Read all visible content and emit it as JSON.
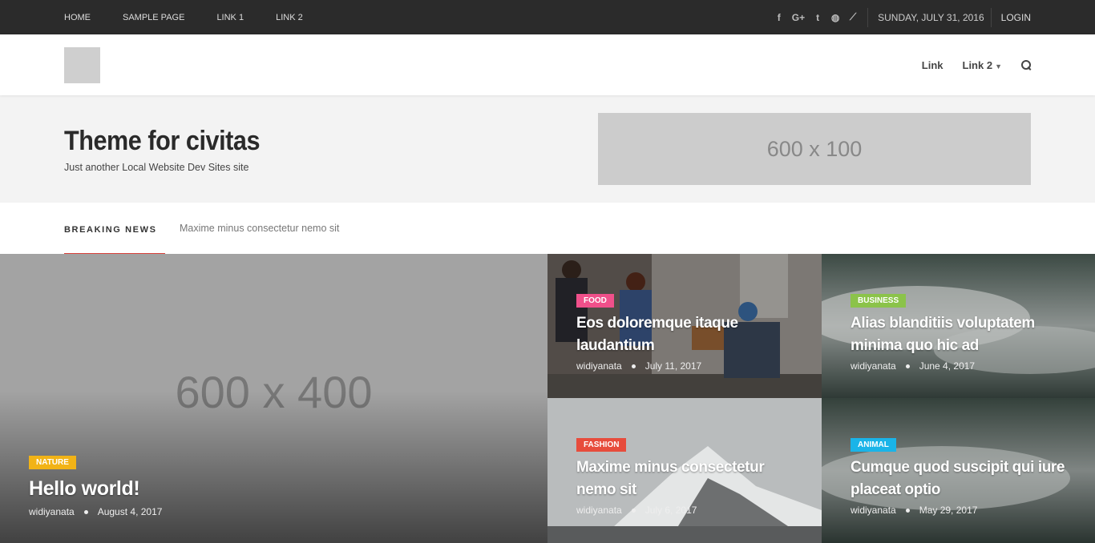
{
  "topbar": {
    "nav": [
      "HOME",
      "SAMPLE PAGE",
      "LINK 1",
      "LINK 2"
    ],
    "social_icons": [
      "facebook-icon",
      "google-plus-icon",
      "twitter-icon",
      "dribbble-icon",
      "rss-icon"
    ],
    "date": "SUNDAY, JULY 31, 2016",
    "login": "LOGIN"
  },
  "header": {
    "nav": [
      "Link",
      "Link 2"
    ]
  },
  "branding": {
    "title": "Theme for civitas",
    "description": "Just another Local Website Dev Sites site",
    "ad_text": "600 x 100"
  },
  "breaking": {
    "label": "BREAKING NEWS",
    "text": "Maxime minus consectetur nemo sit"
  },
  "featured": {
    "placeholder": "600 x 400",
    "category": "NATURE",
    "category_color": "#f2b316",
    "title": "Hello world!",
    "author": "widiyanata",
    "date": "August 4, 2017"
  },
  "posts": [
    {
      "category": "FOOD",
      "category_color": "#f0508a",
      "title": "Eos doloremque itaque laudantium",
      "author": "widiyanata",
      "date": "July 11, 2017"
    },
    {
      "category": "BUSINESS",
      "category_color": "#8bc34a",
      "title": "Alias blanditiis voluptatem minima quo hic ad",
      "author": "widiyanata",
      "date": "June 4, 2017"
    },
    {
      "category": "FASHION",
      "category_color": "#e74c3c",
      "title": "Maxime minus consectetur nemo sit",
      "author": "widiyanata",
      "date": "July 6, 2017"
    },
    {
      "category": "ANIMAL",
      "category_color": "#1ab4e8",
      "title": "Cumque quod suscipit qui iure placeat optio",
      "author": "widiyanata",
      "date": "May 29, 2017"
    }
  ]
}
